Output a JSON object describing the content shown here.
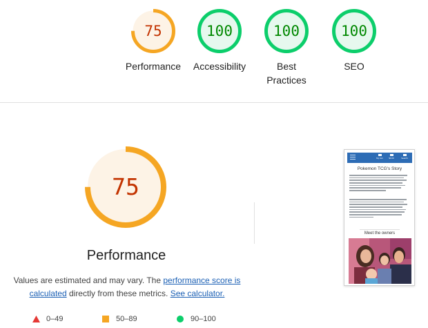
{
  "categories": [
    {
      "label": "Performance",
      "score": "75",
      "value": 75,
      "status": "average"
    },
    {
      "label": "Accessibility",
      "score": "100",
      "value": 100,
      "status": "pass"
    },
    {
      "label": "Best\nPractices",
      "score": "100",
      "value": 100,
      "status": "pass"
    },
    {
      "label": "SEO",
      "score": "100",
      "value": 100,
      "status": "pass"
    }
  ],
  "main": {
    "score": "75",
    "value": 75,
    "title": "Performance",
    "desc_prefix": "Values are estimated and may vary. The ",
    "link_score": "performance score is calculated",
    "desc_middle": " directly from these metrics. ",
    "link_calc": "See calculator."
  },
  "legend": [
    {
      "range": "0–49",
      "shape": "triangle",
      "color": "#e53935"
    },
    {
      "range": "50–89",
      "shape": "square",
      "color": "#f5a623"
    },
    {
      "range": "90–100",
      "shape": "circle",
      "color": "#0cce6b"
    }
  ],
  "colors": {
    "average_stroke": "#f5a623",
    "average_fill": "#fdf3e6",
    "average_text": "#c33300",
    "pass_stroke": "#0cce6b",
    "pass_fill": "#e6f8ee",
    "pass_text": "#008800"
  },
  "screenshot": {
    "title": "Pokemon TCG's Story",
    "nav_items": [
      "My Acc",
      "$0.00",
      "Search"
    ],
    "menu_icon": "hamburger-icon",
    "section_title": "Meet the owners"
  }
}
